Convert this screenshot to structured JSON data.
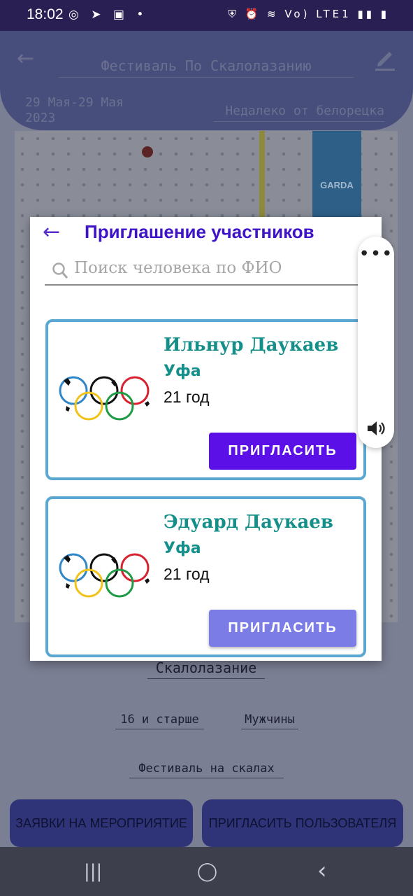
{
  "status_bar": {
    "time": "18:02",
    "left_icons": "◎ ➤ ▣ •",
    "right_icons": "⛨ ⏰ ≋ Vo) LTE1 ▮▮ ▮"
  },
  "event": {
    "title": "Фестиваль По Скалолазанию",
    "date": "29 Мая-29 Мая\n2023",
    "location": "Недалеко от белорецка",
    "sport": "Скалолазание",
    "age": "16 и старше",
    "gender": "Мужчины",
    "type": "Фестиваль на скалах"
  },
  "photo": {
    "banner_text": "GARDA"
  },
  "buttons": {
    "applications": "ЗАЯВКИ НА МЕРОПРИЯТИЕ",
    "invite_user": "ПРИГЛАСИТЬ ПОЛЬЗОВАТЕЛЯ"
  },
  "dialog": {
    "title": "Приглашение участников",
    "search_placeholder": "Поиск человека по ФИО",
    "participants": [
      {
        "name": "Ильнур Даукаев",
        "city": "Уфа",
        "age": "21 год",
        "button": "ПРИГЛАСИТЬ",
        "button_state": "active"
      },
      {
        "name": "Эдуард Даукаев",
        "city": "Уфа",
        "age": "21 год",
        "button": "ПРИГЛАСИТЬ",
        "button_state": "pressed"
      }
    ]
  },
  "navbar": {
    "recent": "|||",
    "home": "◯",
    "back": "‹"
  },
  "colors": {
    "accent": "#5c10e8",
    "title": "#3f14c8",
    "name_teal": "#148f8a",
    "card_border": "#5aa7d1",
    "header_dim": "#474e7c"
  },
  "icons": [
    "back-arrow-icon",
    "edit-icon",
    "search-icon",
    "olympic-rings-icon",
    "more-icon",
    "volume-icon"
  ]
}
